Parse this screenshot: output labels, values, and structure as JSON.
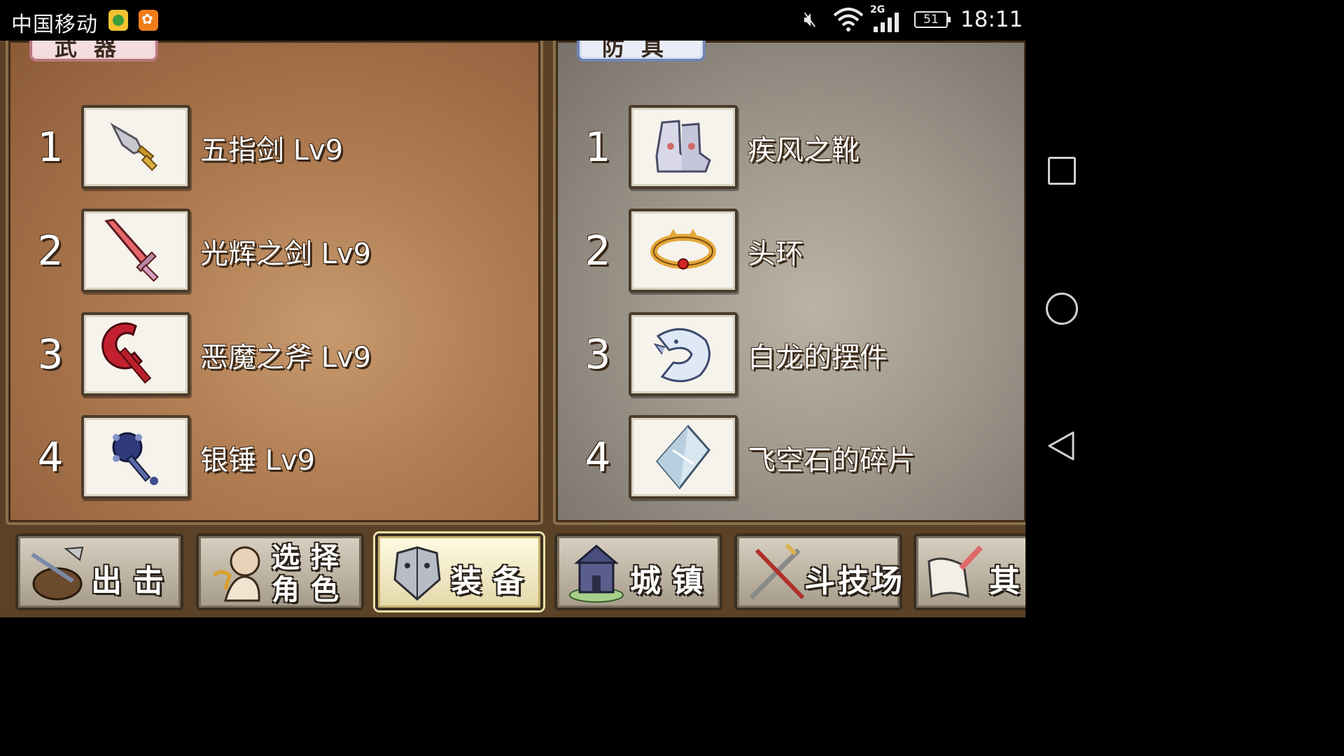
{
  "status_bar": {
    "carrier": "中国移动",
    "network": "2G",
    "battery": "51",
    "time": "18:11"
  },
  "weapon_panel": {
    "tab_title": "武器",
    "items": [
      {
        "num": "1",
        "name": "五指剑 Lv9",
        "icon": "dagger-icon"
      },
      {
        "num": "2",
        "name": "光辉之剑 Lv9",
        "icon": "sword-icon"
      },
      {
        "num": "3",
        "name": "恶魔之斧 Lv9",
        "icon": "axe-icon"
      },
      {
        "num": "4",
        "name": "银锤 Lv9",
        "icon": "mace-icon"
      }
    ]
  },
  "armor_panel": {
    "tab_title": "防具",
    "items": [
      {
        "num": "1",
        "name": "疾风之靴",
        "icon": "boots-icon"
      },
      {
        "num": "2",
        "name": "头环",
        "icon": "circlet-icon"
      },
      {
        "num": "3",
        "name": "白龙的摆件",
        "icon": "dragon-icon"
      },
      {
        "num": "4",
        "name": "飞空石的碎片",
        "icon": "crystal-shard-icon"
      }
    ]
  },
  "menu": [
    {
      "label": "出击",
      "icon": "sortie-ship-icon",
      "active": false
    },
    {
      "label": "选择角色",
      "icon": "character-select-icon",
      "active": false
    },
    {
      "label": "装备",
      "icon": "equipment-armor-icon",
      "active": true
    },
    {
      "label": "城镇",
      "icon": "town-icon",
      "active": false
    },
    {
      "label": "斗技场",
      "icon": "arena-swords-icon",
      "active": false
    },
    {
      "label": "其",
      "icon": "other-scroll-icon",
      "active": false
    }
  ],
  "nav_bar": {
    "icons": [
      "recent-apps-icon",
      "home-icon",
      "back-icon"
    ]
  },
  "colors": {
    "weapon_bg": "#b07c52",
    "armor_bg": "#9f978b",
    "menu_active": "#fffbe4"
  }
}
